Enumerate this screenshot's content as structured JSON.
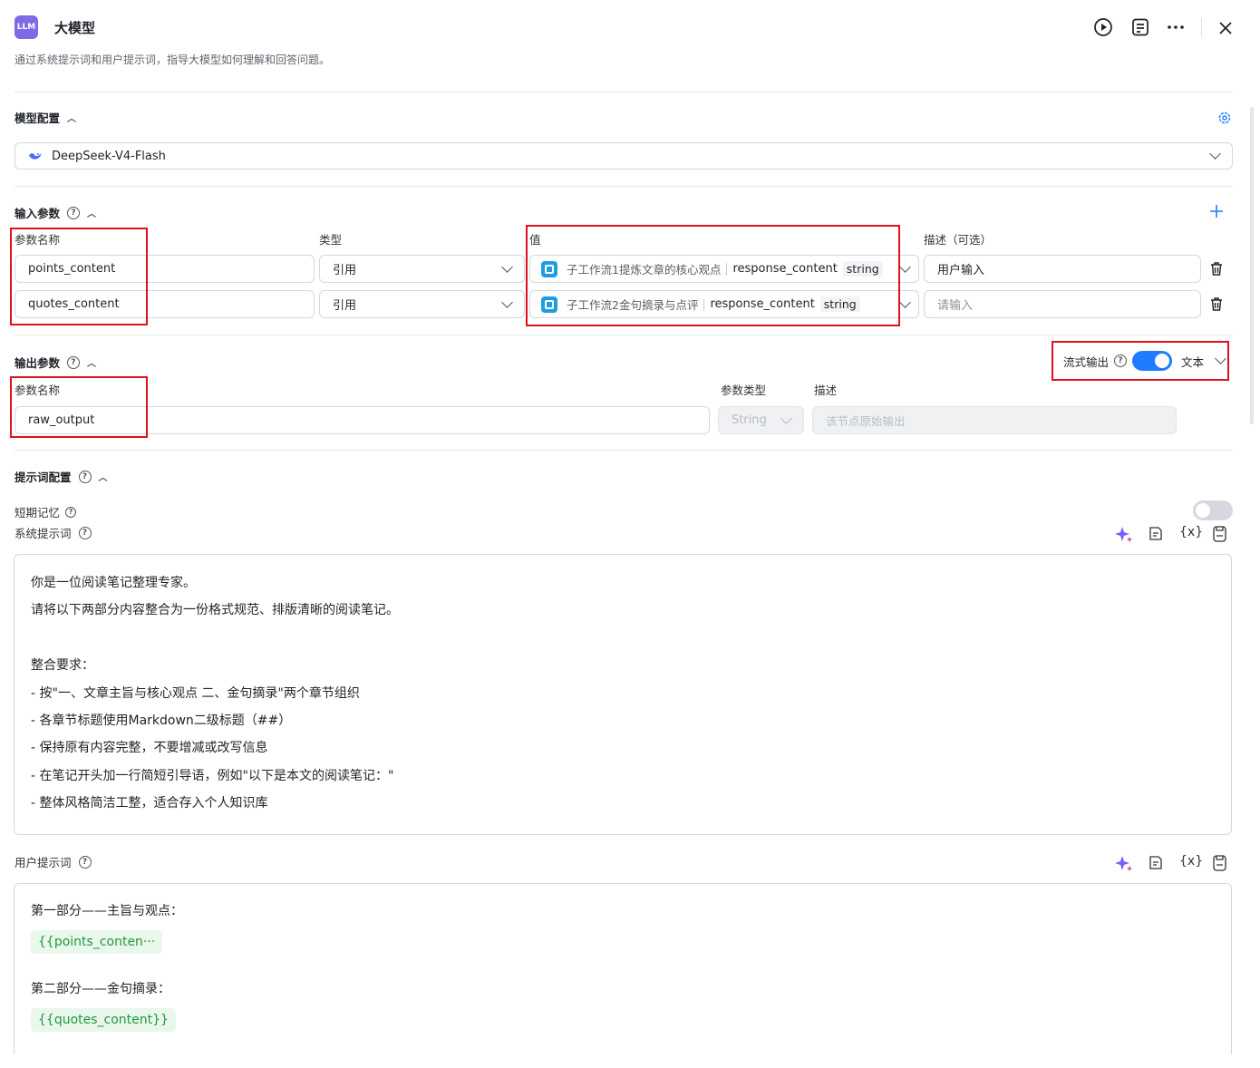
{
  "header": {
    "logo_text": "LLM",
    "title": "大模型",
    "description": "通过系统提示词和用户提示词，指导大模型如何理解和回答问题。"
  },
  "model_config": {
    "section_title": "模型配置",
    "model_name": "DeepSeek-V4-Flash"
  },
  "input_params": {
    "section_title": "输入参数",
    "col_name": "参数名称",
    "col_type": "类型",
    "col_value": "值",
    "col_desc": "描述（可选）",
    "rows": [
      {
        "name": "points_content",
        "type": "引用",
        "source_node": "子工作流1提炼文章的核心观点",
        "source_field": "response_content",
        "source_type": "string",
        "description": "用户输入",
        "desc_placeholder": ""
      },
      {
        "name": "quotes_content",
        "type": "引用",
        "source_node": "子工作流2金句摘录与点评",
        "source_field": "response_content",
        "source_type": "string",
        "description": "",
        "desc_placeholder": "请输入"
      }
    ]
  },
  "output_params": {
    "section_title": "输出参数",
    "stream_label": "流式输出",
    "stream_enabled": true,
    "format": "文本",
    "col_name": "参数名称",
    "col_type": "参数类型",
    "col_desc": "描述",
    "name": "raw_output",
    "type": "String",
    "desc_placeholder": "该节点原始输出"
  },
  "prompt_config": {
    "section_title": "提示词配置",
    "short_memory_label": "短期记忆",
    "short_memory_enabled": false,
    "system_prompt_label": "系统提示词",
    "system_prompt_lines": [
      "你是一位阅读笔记整理专家。",
      "请将以下两部分内容整合为一份格式规范、排版清晰的阅读笔记。",
      "",
      "整合要求：",
      "- 按\"一、文章主旨与核心观点 二、金句摘录\"两个章节组织",
      "- 各章节标题使用Markdown二级标题（##）",
      "- 保持原有内容完整，不要增减或改写信息",
      "- 在笔记开头加一行简短引导语，例如\"以下是本文的阅读笔记：\"",
      "- 整体风格简洁工整，适合存入个人知识库"
    ],
    "user_prompt_label": "用户提示词",
    "user_prompt": {
      "part1": "第一部分——主旨与观点：",
      "var1": "{{points_conten···",
      "part2": "第二部分——金句摘录：",
      "var2": "{{quotes_content}}"
    },
    "tool_var_label": "{x}"
  }
}
